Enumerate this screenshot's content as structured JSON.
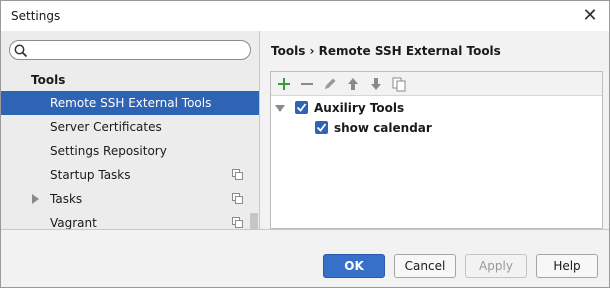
{
  "window": {
    "title": "Settings"
  },
  "search": {
    "placeholder": ""
  },
  "sidebar": {
    "section": "Tools",
    "items": [
      {
        "label": "Remote SSH External Tools",
        "selected": true
      },
      {
        "label": "Server Certificates"
      },
      {
        "label": "Settings Repository"
      },
      {
        "label": "Startup Tasks",
        "icon": "copy-icon"
      },
      {
        "label": "Tasks",
        "icon": "copy-icon",
        "expandable": true
      },
      {
        "label": "Vagrant",
        "icon": "copy-icon"
      }
    ]
  },
  "breadcrumb": {
    "parent": "Tools",
    "separator": "›",
    "current": "Remote SSH External Tools"
  },
  "toolbar": [
    "add-icon",
    "remove-icon",
    "edit-icon",
    "move-up-icon",
    "move-down-icon",
    "copy-icon"
  ],
  "tree": {
    "group": {
      "label": "Auxiliry Tools",
      "checked": true
    },
    "child": {
      "label": "show calendar",
      "checked": true
    }
  },
  "buttons": {
    "ok": "OK",
    "cancel": "Cancel",
    "apply": "Apply",
    "help": "Help"
  },
  "colors": {
    "accent": "#2f64b4",
    "add": "#3a9a3a"
  }
}
